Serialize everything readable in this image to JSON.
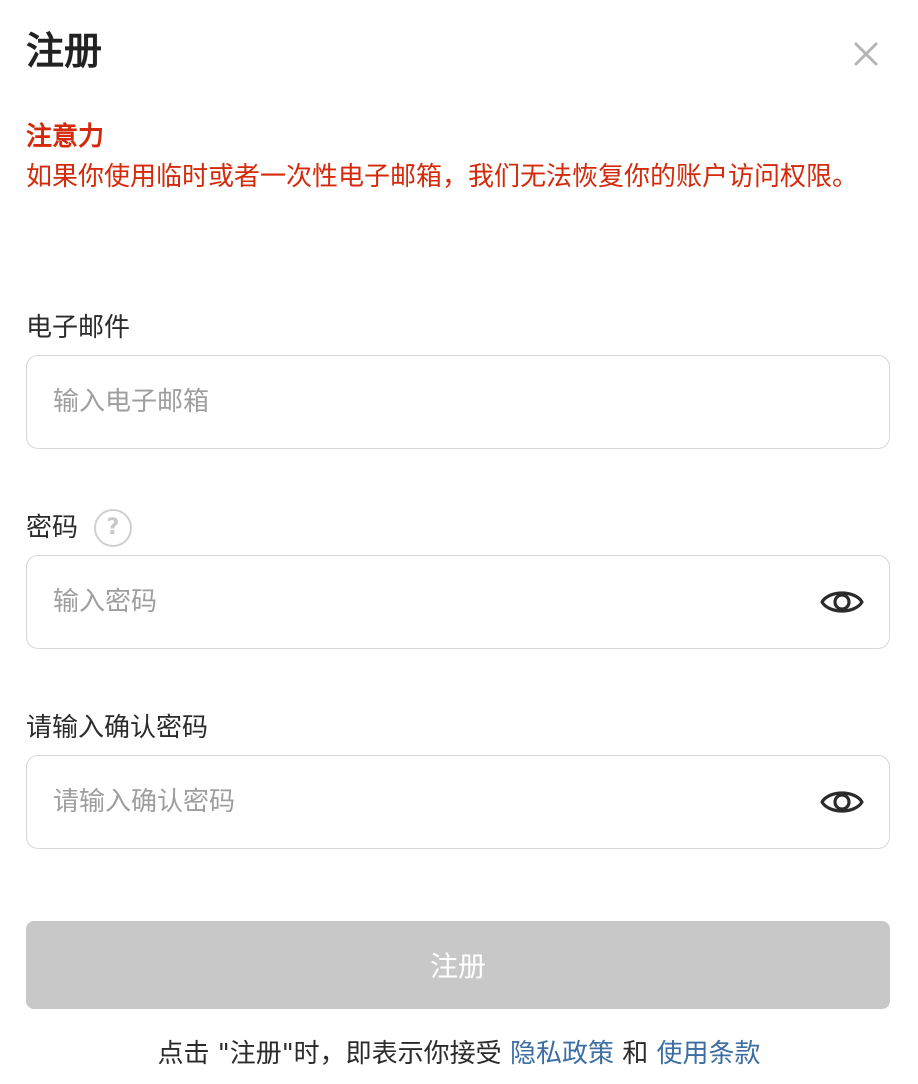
{
  "header": {
    "title": "注册",
    "close_icon": "close-icon"
  },
  "warning": {
    "title": "注意力",
    "text": "如果你使用临时或者一次性电子邮箱，我们无法恢复你的账户访问权限。",
    "color": "#d42a0b"
  },
  "email": {
    "label": "电子邮件",
    "placeholder": "输入电子邮箱",
    "value": ""
  },
  "password": {
    "label": "密码",
    "help_icon": "question-circle-icon",
    "help_glyph": "?",
    "placeholder": "输入密码",
    "value": "",
    "toggle_icon": "eye-icon"
  },
  "confirm_password": {
    "label": "请输入确认密码",
    "placeholder": "请输入确认密码",
    "value": "",
    "toggle_icon": "eye-icon"
  },
  "submit": {
    "label": "注册",
    "disabled": true,
    "color": "#c8c8c8"
  },
  "footer": {
    "prefix": "点击 \"注册\"时，即表示你接受",
    "privacy_link": "隐私政策",
    "conjunction": "和",
    "terms_link": "使用条款",
    "link_color": "#3c6ea3"
  }
}
